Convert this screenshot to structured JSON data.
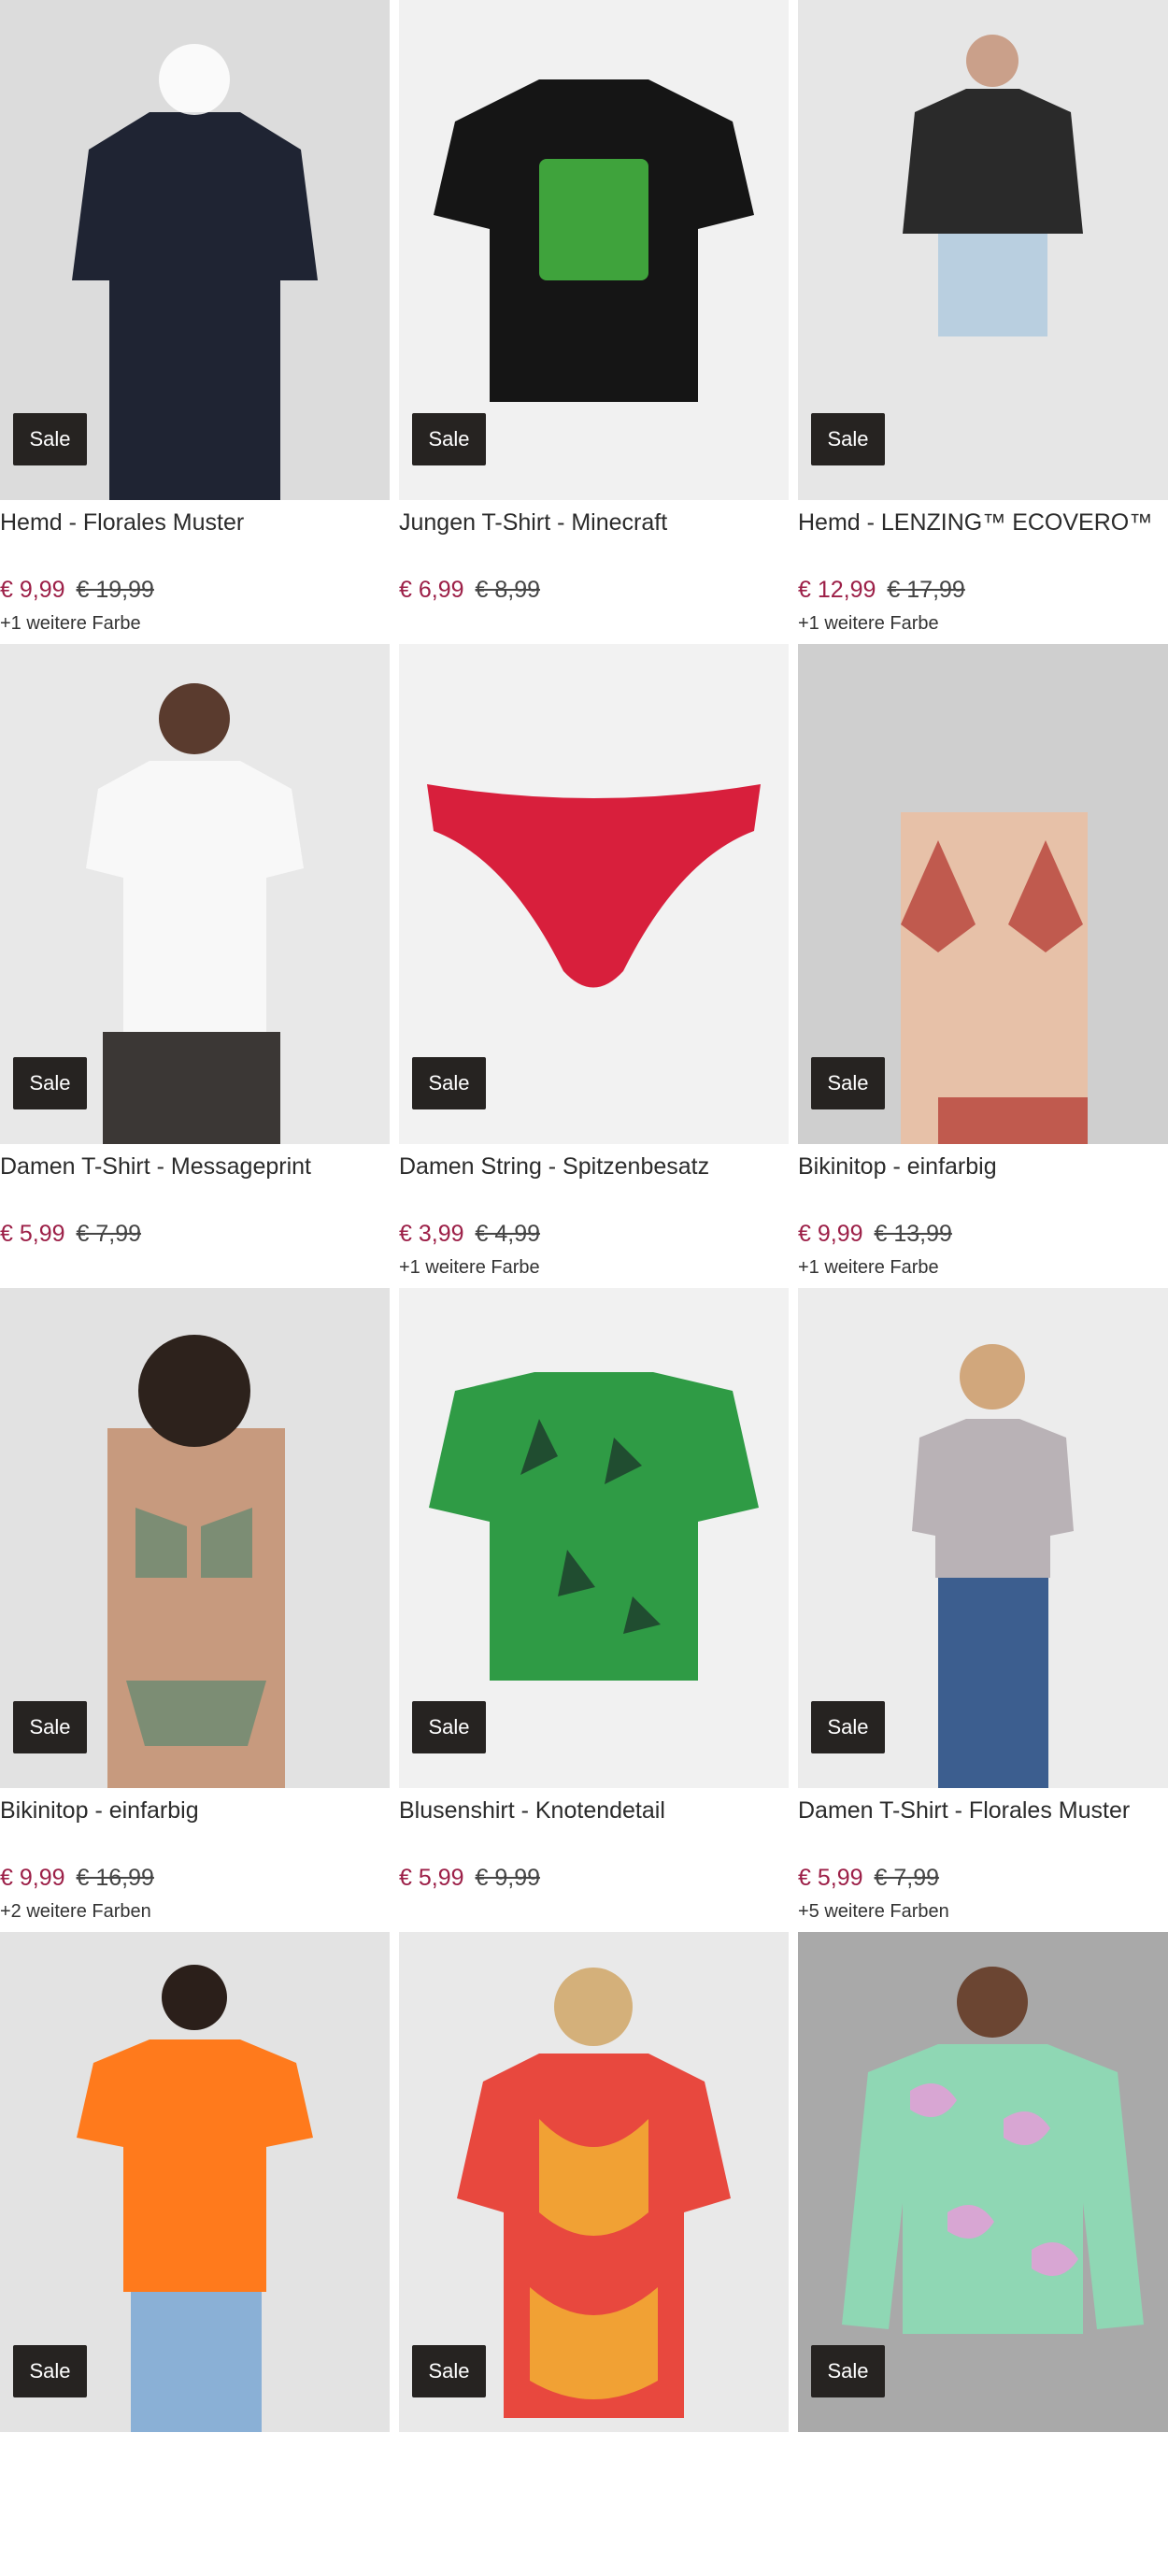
{
  "products": [
    {
      "badge": "Sale",
      "title": "Hemd - Florales Muster",
      "price_now": "€ 9,99",
      "price_old": "€ 19,99",
      "colors": "+1 weitere Farbe",
      "bg": "#dcdcdc",
      "garment": "#1f2433",
      "accent": "#ffffff"
    },
    {
      "badge": "Sale",
      "title": "Jungen T-Shirt - Minecraft",
      "price_now": "€ 6,99",
      "price_old": "€ 8,99",
      "colors": "",
      "bg": "#f1f1f1",
      "garment": "#151515",
      "accent": "#3fa33c"
    },
    {
      "badge": "Sale",
      "title": "Hemd - LENZING™ ECOVERO™",
      "price_now": "€ 12,99",
      "price_old": "€ 17,99",
      "colors": "+1 weitere Farbe",
      "bg": "#e6e6e6",
      "garment": "#2a2a2a",
      "accent": "#b9cfe0"
    },
    {
      "badge": "Sale",
      "title": "Damen T-Shirt - Messageprint",
      "price_now": "€ 5,99",
      "price_old": "€ 7,99",
      "colors": "",
      "bg": "#e8e8e8",
      "garment": "#f8f8f8",
      "accent": "#3b3735"
    },
    {
      "badge": "Sale",
      "title": "Damen String - Spitzenbesatz",
      "price_now": "€ 3,99",
      "price_old": "€ 4,99",
      "colors": "+1 weitere Farbe",
      "bg": "#f2f2f2",
      "garment": "#d81f3c",
      "accent": "#d81f3c"
    },
    {
      "badge": "Sale",
      "title": "Bikinitop - einfarbig",
      "price_now": "€ 9,99",
      "price_old": "€ 13,99",
      "colors": "+1 weitere Farbe",
      "bg": "#cfcfcf",
      "garment": "#c05a4e",
      "accent": "#e7c1a8"
    },
    {
      "badge": "Sale",
      "title": "Bikinitop - einfarbig",
      "price_now": "€ 9,99",
      "price_old": "€ 16,99",
      "colors": "+2 weitere Farben",
      "bg": "#e2e2e2",
      "garment": "#7c8d74",
      "accent": "#c79a7e"
    },
    {
      "badge": "Sale",
      "title": "Blusenshirt - Knotendetail",
      "price_now": "€ 5,99",
      "price_old": "€ 9,99",
      "colors": "",
      "bg": "#f1f1f1",
      "garment": "#2f9b45",
      "accent": "#1d3a2a"
    },
    {
      "badge": "Sale",
      "title": "Damen T-Shirt - Florales Muster",
      "price_now": "€ 5,99",
      "price_old": "€ 7,99",
      "colors": "+5 weitere Farben",
      "bg": "#ececec",
      "garment": "#b9b2b6",
      "accent": "#3c5e8f"
    },
    {
      "badge": "Sale",
      "title": "",
      "price_now": "",
      "price_old": "",
      "colors": "",
      "bg": "#e3e3e3",
      "garment": "#ff7a1c",
      "accent": "#8ab0d6"
    },
    {
      "badge": "Sale",
      "title": "",
      "price_now": "",
      "price_old": "",
      "colors": "",
      "bg": "#e9e9e9",
      "garment": "#e8483e",
      "accent": "#f2b233"
    },
    {
      "badge": "Sale",
      "title": "",
      "price_now": "",
      "price_old": "",
      "colors": "",
      "bg": "#a9a9a9",
      "garment": "#8fd7b4",
      "accent": "#e0a1d6"
    }
  ]
}
